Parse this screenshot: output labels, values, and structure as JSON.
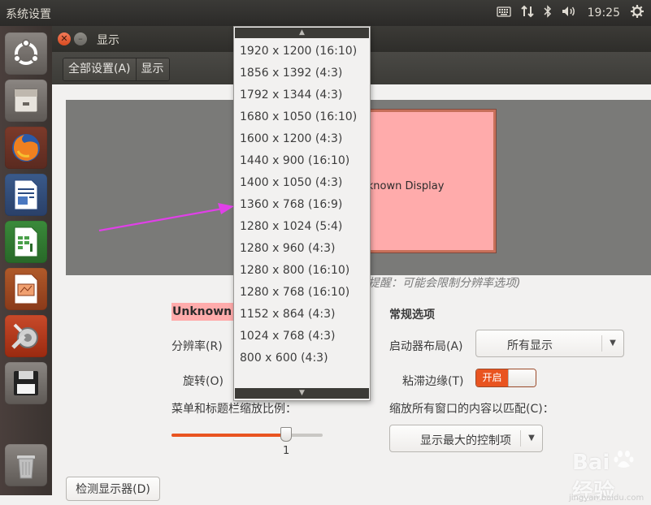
{
  "topbar": {
    "title": "系统设置",
    "time": "19:25"
  },
  "window": {
    "title": "显示"
  },
  "breadcrumb": {
    "all_settings": "全部设置(A)",
    "current": "显示"
  },
  "preview": {
    "display_name": "Unknown Display"
  },
  "hint": "提醒：可能会限制分辨率选项)",
  "left_panel": {
    "display_name": "Unknown D",
    "resolution_label": "分辨率(R)",
    "rotation_label": "旋转(O)",
    "scale_label": "菜单和标题栏缩放比例：",
    "scale_value": "1",
    "scale_fraction": 0.76
  },
  "general": {
    "heading": "常规选项",
    "launcher_label": "启动器布局(A)",
    "launcher_value": "所有显示",
    "sticky_label": "粘滞边缘(T)",
    "sticky_state": "开启",
    "scale_all_label": "缩放所有窗口的内容以匹配(C)：",
    "scale_all_value": "显示最大的控制项"
  },
  "detect_button": "检测显示器(D)",
  "resolutions": [
    "1920 x 1200 (16:10)",
    "1856 x 1392 (4:3)",
    "1792 x 1344 (4:3)",
    "1680 x 1050 (16:10)",
    "1600 x 1200 (4:3)",
    "1440 x 900 (16:10)",
    "1400 x 1050 (4:3)",
    "1360 x 768 (16:9)",
    "1280 x 1024 (5:4)",
    "1280 x 960 (4:3)",
    "1280 x 800 (16:10)",
    "1280 x 768 (16:10)",
    "1152 x 864 (4:3)",
    "1024 x 768 (4:3)",
    "800 x 600 (4:3)"
  ],
  "watermark": {
    "brand": "Bai",
    "text": "经验",
    "url": "jingyan.baidu.com"
  },
  "colors": {
    "accent": "#e95420",
    "highlight": "#ffabab",
    "arrow": "#e040e8"
  }
}
